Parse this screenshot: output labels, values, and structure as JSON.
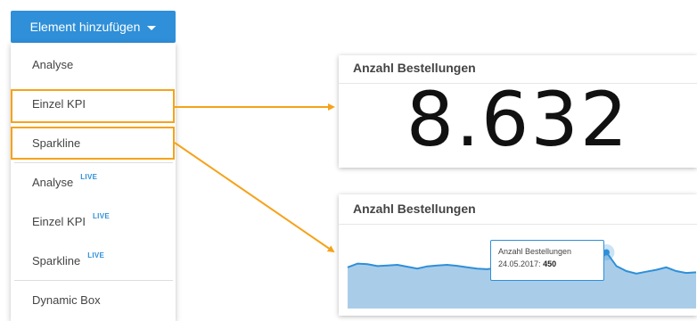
{
  "menu": {
    "button_label": "Element hinzufügen",
    "items": [
      {
        "label": "Analyse",
        "live": ""
      },
      {
        "label": "Einzel KPI",
        "live": ""
      },
      {
        "label": "Sparkline",
        "live": ""
      },
      {
        "label": "Analyse",
        "live": "LIVE"
      },
      {
        "label": "Einzel KPI",
        "live": "LIVE"
      },
      {
        "label": "Sparkline",
        "live": "LIVE"
      },
      {
        "label": "Dynamic Box",
        "live": ""
      }
    ]
  },
  "kpi_card": {
    "title": "Anzahl Bestellungen",
    "value": "8.632"
  },
  "sparkline_card": {
    "title": "Anzahl Bestellungen",
    "tooltip_label": "Anzahl Bestellungen",
    "tooltip_date": "24.05.2017:",
    "tooltip_value": "450"
  },
  "chart_data": {
    "type": "area",
    "title": "Anzahl Bestellungen",
    "xlabel": "",
    "ylabel": "",
    "y": [
      330,
      360,
      355,
      340,
      345,
      350,
      335,
      320,
      338,
      345,
      350,
      342,
      330,
      320,
      315,
      325,
      340,
      345,
      335,
      320,
      300,
      315,
      325,
      320,
      330,
      345,
      450,
      340,
      300,
      280,
      295,
      310,
      330,
      300,
      285,
      290
    ],
    "highlight_index": 26,
    "grid": false
  },
  "colors": {
    "accent": "#2f8fd8",
    "highlight": "#f5a31a",
    "sparkline_fill": "#a9cde9",
    "sparkline_line": "#2f8fd8"
  }
}
